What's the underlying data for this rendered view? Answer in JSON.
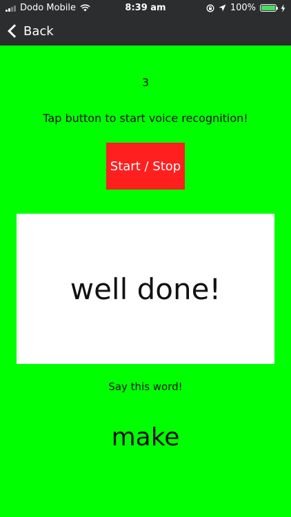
{
  "status_bar": {
    "carrier": "Dodo Mobile",
    "time": "8:39 am",
    "battery": "100%",
    "battery_level": 1.0,
    "icons": [
      "signal-icon",
      "wifi-icon",
      "screen-lock-icon",
      "location-icon",
      "battery-icon",
      "charging-icon"
    ]
  },
  "navbar": {
    "back_label": "Back"
  },
  "main": {
    "count": "3",
    "instruction": "Tap button to start voice recognition!",
    "start_stop_label": "Start / Stop",
    "result_text": "well done!",
    "prompt": "Say this word!",
    "target_word": "make"
  },
  "colors": {
    "background": "#00ff00",
    "bar": "#2b2d2f",
    "button": "#ff1f1f",
    "battery_fill": "#4cd964"
  }
}
